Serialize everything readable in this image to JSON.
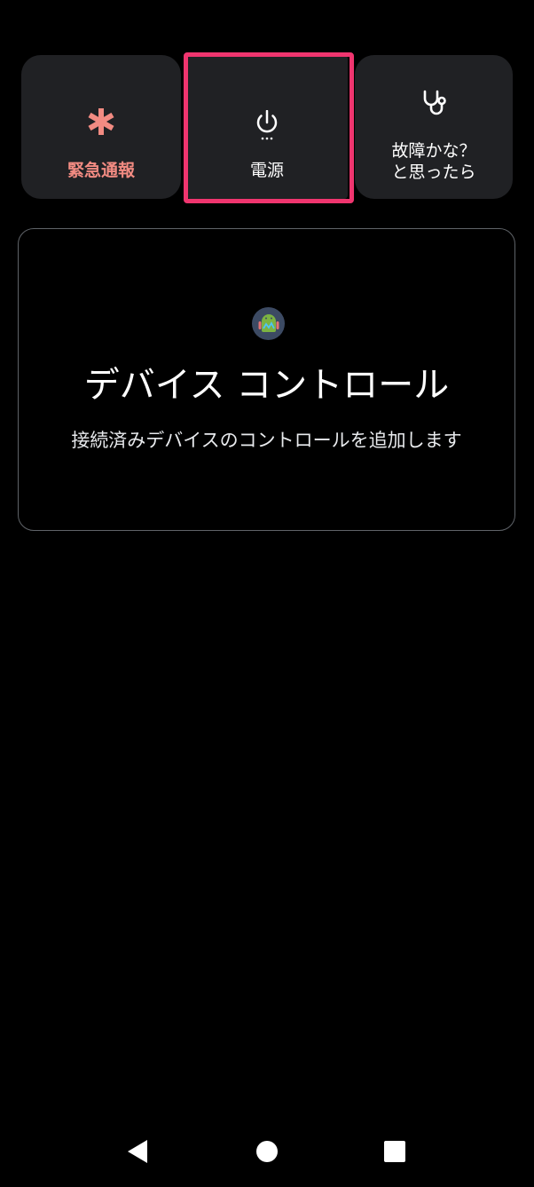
{
  "quick_tiles": {
    "emergency": {
      "label": "緊急通報",
      "icon": "asterisk-icon",
      "color": "#f28b82"
    },
    "power": {
      "label": "電源",
      "icon": "power-icon"
    },
    "trouble": {
      "label": "故障かな？\nと思ったら",
      "icon": "stethoscope-icon"
    }
  },
  "device_controls": {
    "app_icon": "android-app-icon",
    "title": "デバイス コントロール",
    "subtitle": "接続済みデバイスのコントロールを追加します"
  },
  "nav_bar": {
    "back_icon": "back-triangle-icon",
    "home_icon": "home-circle-icon",
    "recents_icon": "recents-square-icon"
  },
  "highlight_color": "#f0356f",
  "tile_bg": "#202124"
}
